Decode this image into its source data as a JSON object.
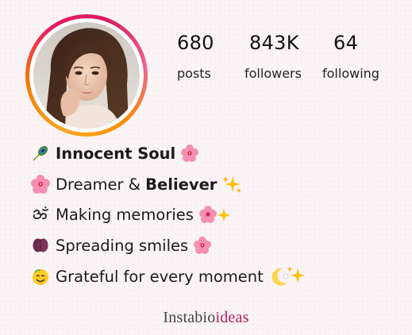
{
  "profile": {
    "avatar_alt": "profile photo"
  },
  "stats": {
    "posts": {
      "value": "680",
      "label": "posts"
    },
    "followers": {
      "value": "843K",
      "label": "followers"
    },
    "following": {
      "value": "64",
      "label": "following"
    }
  },
  "bio": {
    "line1": {
      "icon": "peacock-feather-icon",
      "text": "Innocent Soul",
      "trail_icon": "hibiscus-icon"
    },
    "line2": {
      "icon": "hibiscus-icon",
      "text_a": "Dreamer & ",
      "text_b": "Believer",
      "trail_icon": "sparkles-icon"
    },
    "line3": {
      "icon": "om-symbol-icon",
      "text": "Making memories",
      "trail_icon": "hibiscus-sparkles-icon"
    },
    "line4": {
      "icon": "lips-icon",
      "text": "Spreading smiles",
      "trail_icon": "hibiscus-icon"
    },
    "line5": {
      "icon": "smiling-face-icon",
      "text": "Grateful for every moment",
      "trail_icon": "moon-sparkles-icon"
    }
  },
  "watermark": {
    "text_a": "Instabio",
    "text_b": "ideas"
  },
  "colors": {
    "ring_orange": "#f57c00",
    "ring_pink": "#e91e63",
    "background": "#fbf4f6",
    "accent": "#c2185b"
  }
}
